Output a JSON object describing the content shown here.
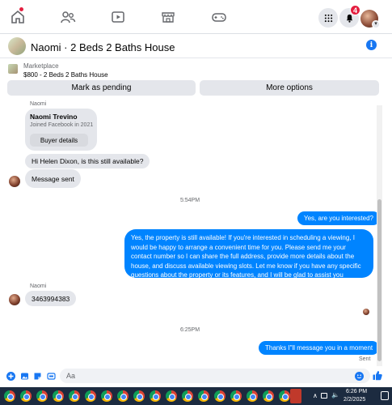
{
  "topnav": {
    "icons": [
      "home-icon",
      "friends-icon",
      "video-icon",
      "marketplace-icon",
      "gaming-icon",
      "menu-grid-icon",
      "notifications-icon"
    ],
    "notification_count": "4"
  },
  "header": {
    "title": "Naomi · 2 Beds 2 Baths House"
  },
  "listing": {
    "category": "Marketplace",
    "price_title": "$800 - 2 Beds 2 Baths House",
    "mark_pending_label": "Mark as pending",
    "more_options_label": "More options"
  },
  "messages": {
    "sender_label_top": "Naomi",
    "card_name": "Naomi Trevino",
    "card_sub": "Joined Facebook in 2021",
    "card_button": "Buyer details",
    "msg_1": "Hi Helen Dixon, is this still available?",
    "msg_2": "Message sent",
    "time_1": "5:54PM",
    "out_1": "Yes, are you interested?",
    "out_2": "Yes, the property is still available! If you're interested in scheduling a viewing, I would be happy to arrange a convenient time for you. Please send me your contact number so I can share the full address, provide more details about the house, and discuss available viewing slots. Let me know if you have any specific questions about the property or its features, and I will be glad to assist you",
    "sender_label_2": "Naomi",
    "msg_3": "3463994383",
    "time_2": "6:25PM",
    "out_3": "Thanks I\"ll message you in a moment",
    "sent_status": "Sent"
  },
  "composer": {
    "placeholder": "Aa"
  },
  "taskbar": {
    "time": "6:26 PM",
    "date": "2/2/2025"
  },
  "colors": {
    "accent": "#0084ff",
    "brand": "#1877f2",
    "bubble_in": "#e4e6eb",
    "badge": "#e41e3f",
    "taskbar": "#1c2b40"
  }
}
